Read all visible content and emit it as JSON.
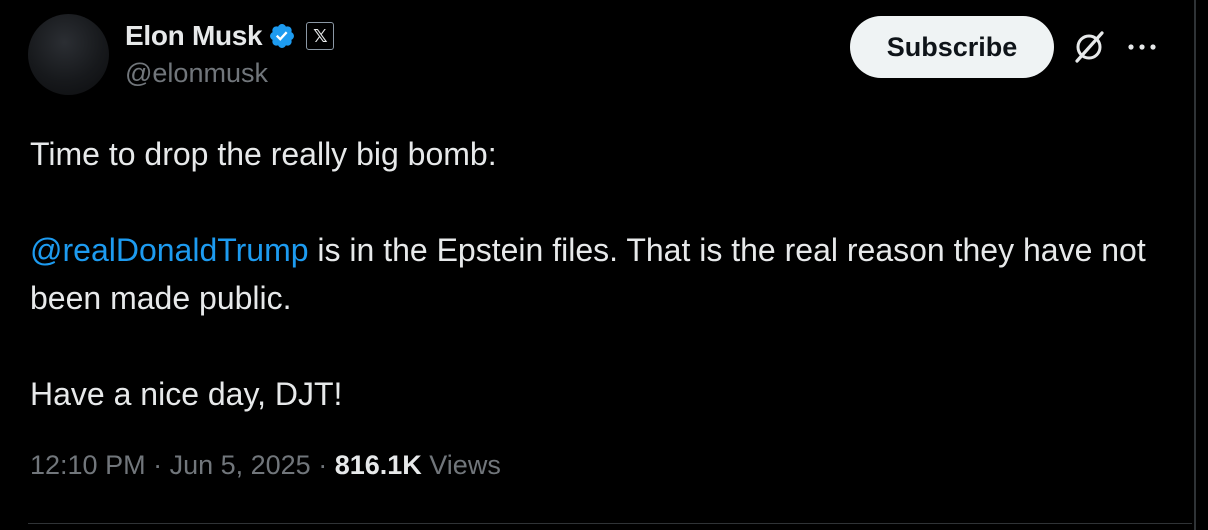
{
  "author": {
    "display_name": "Elon Musk",
    "handle": "@elonmusk",
    "verified_color": "#1d9bf0",
    "affiliate_badge": "𝕏"
  },
  "actions": {
    "subscribe_label": "Subscribe",
    "grok_icon": "grok-icon",
    "more_icon": "more-icon"
  },
  "tweet": {
    "line1": "Time to drop the really big bomb:",
    "mention": "@realDonaldTrump",
    "line2_rest": " is in the Epstein files. That is the real reason they have not been made public.",
    "line3": "Have a nice day, DJT!"
  },
  "meta": {
    "time": "12:10 PM",
    "sep1": " · ",
    "date": "Jun 5, 2025",
    "sep2": " · ",
    "views_count": "816.1K",
    "views_label": " Views"
  },
  "colors": {
    "background": "#000000",
    "text": "#e7e9ea",
    "secondary": "#71767b",
    "accent": "#1d9bf0"
  }
}
